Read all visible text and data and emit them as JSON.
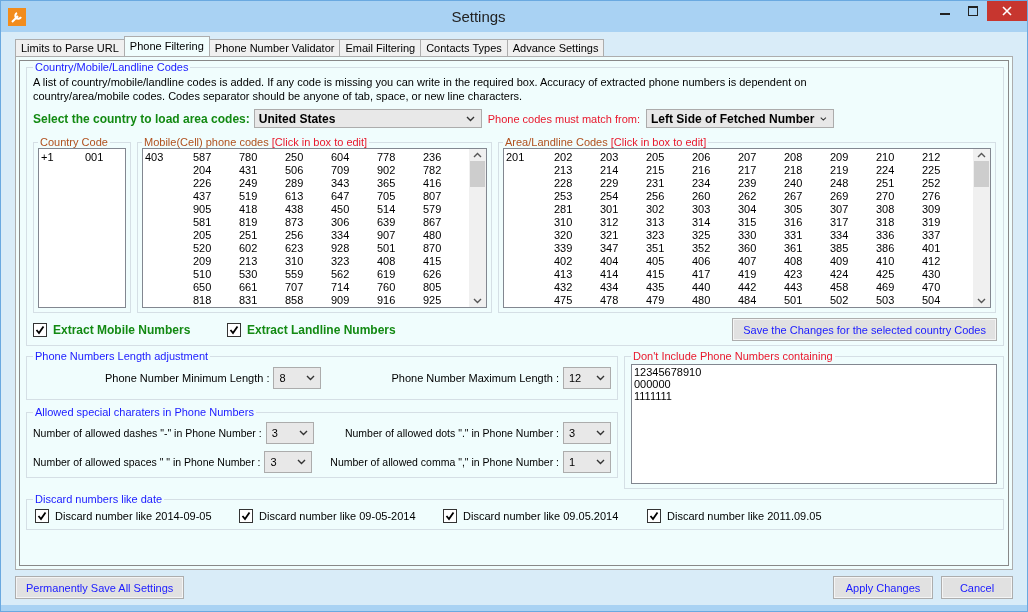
{
  "window": {
    "title": "Settings"
  },
  "tabs": [
    {
      "label": "Limits to Parse URL",
      "selected": false
    },
    {
      "label": "Phone Filtering",
      "selected": true
    },
    {
      "label": "Phone Number Validator",
      "selected": false
    },
    {
      "label": "Email Filtering",
      "selected": false
    },
    {
      "label": "Contacts Types",
      "selected": false
    },
    {
      "label": "Advance Settings",
      "selected": false
    }
  ],
  "codes_group": {
    "title": "Country/Mobile/Landline Codes",
    "description": "A list of country/mobile/landline codes is added. If any code is missing you can write in the required box. Accuracy of extracted phone numbers is dependent on country/area/mobile codes. Codes separator should be anyone of tab, space, or new line characters.",
    "country_select": {
      "label": "Select the country to load area codes:",
      "value": "United States"
    },
    "match_select": {
      "label": "Phone codes must match from:",
      "value": "Left Side of Fetched Number"
    },
    "country_codes": {
      "title": "Country Code",
      "values": [
        "+1",
        "001"
      ]
    },
    "mobile_codes": {
      "title": "Mobile(Cell) phone codes",
      "hint": "[Click in box to edit]",
      "first": "403",
      "rows": [
        [
          "587",
          "780",
          "250",
          "604",
          "778",
          "236"
        ],
        [
          "204",
          "431",
          "506",
          "709",
          "902",
          "782"
        ],
        [
          "226",
          "249",
          "289",
          "343",
          "365",
          "416"
        ],
        [
          "437",
          "519",
          "613",
          "647",
          "705",
          "807"
        ],
        [
          "905",
          "418",
          "438",
          "450",
          "514",
          "579"
        ],
        [
          "581",
          "819",
          "873",
          "306",
          "639",
          "867"
        ],
        [
          "205",
          "251",
          "256",
          "334",
          "907",
          "480"
        ],
        [
          "520",
          "602",
          "623",
          "928",
          "501",
          "870"
        ],
        [
          "209",
          "213",
          "310",
          "323",
          "408",
          "415"
        ],
        [
          "510",
          "530",
          "559",
          "562",
          "619",
          "626"
        ],
        [
          "650",
          "661",
          "707",
          "714",
          "760",
          "805"
        ],
        [
          "818",
          "831",
          "858",
          "909",
          "916",
          "925"
        ]
      ]
    },
    "area_codes": {
      "title": "Area/Landline Codes",
      "hint": "[Click in box to edit]",
      "first": "201",
      "rows": [
        [
          "202",
          "203",
          "205",
          "206",
          "207",
          "208",
          "209",
          "210",
          "212"
        ],
        [
          "213",
          "214",
          "215",
          "216",
          "217",
          "218",
          "219",
          "224",
          "225"
        ],
        [
          "228",
          "229",
          "231",
          "234",
          "239",
          "240",
          "248",
          "251",
          "252"
        ],
        [
          "253",
          "254",
          "256",
          "260",
          "262",
          "267",
          "269",
          "270",
          "276"
        ],
        [
          "281",
          "301",
          "302",
          "303",
          "304",
          "305",
          "307",
          "308",
          "309"
        ],
        [
          "310",
          "312",
          "313",
          "314",
          "315",
          "316",
          "317",
          "318",
          "319"
        ],
        [
          "320",
          "321",
          "323",
          "325",
          "330",
          "331",
          "334",
          "336",
          "337"
        ],
        [
          "339",
          "347",
          "351",
          "352",
          "360",
          "361",
          "385",
          "386",
          "401"
        ],
        [
          "402",
          "404",
          "405",
          "406",
          "407",
          "408",
          "409",
          "410",
          "412"
        ],
        [
          "413",
          "414",
          "415",
          "417",
          "419",
          "423",
          "424",
          "425",
          "430"
        ],
        [
          "432",
          "434",
          "435",
          "440",
          "442",
          "443",
          "458",
          "469",
          "470"
        ],
        [
          "475",
          "478",
          "479",
          "480",
          "484",
          "501",
          "502",
          "503",
          "504"
        ]
      ]
    },
    "extract_options": [
      {
        "label": "Extract Mobile Numbers",
        "checked": true
      },
      {
        "label": "Extract Landline Numbers",
        "checked": true
      }
    ],
    "save_button": "Save the Changes for the selected country Codes"
  },
  "length_group": {
    "title": "Phone Numbers Length adjustment",
    "fields": [
      {
        "label": "Phone Number Minimum Length :",
        "value": "8"
      },
      {
        "label": "Phone Number Maximum Length :",
        "value": "12"
      }
    ]
  },
  "special_group": {
    "title": "Allowed special charaters in Phone Numbers",
    "fields": [
      {
        "label": "Number of allowed dashes \"-\" in Phone Number :",
        "value": "3"
      },
      {
        "label": "Number of allowed dots \".\" in Phone Number :",
        "value": "3"
      },
      {
        "label": "Number of allowed spaces \" \" in Phone Number :",
        "value": "3"
      },
      {
        "label": "Number of allowed  comma \",\" in Phone Number :",
        "value": "1"
      }
    ]
  },
  "exclude_group": {
    "title": "Don't Include Phone Numbers containing",
    "lines": [
      "12345678910",
      "000000",
      "1111111"
    ]
  },
  "date_group": {
    "title": "Discard numbers like date",
    "options": [
      {
        "label": "Discard number like 2014-09-05",
        "checked": true
      },
      {
        "label": "Discard number like 09-05-2014",
        "checked": true
      },
      {
        "label": "Discard number like 09.05.2014",
        "checked": true
      },
      {
        "label": "Discard number like 2011.09.05",
        "checked": true
      }
    ]
  },
  "buttons": {
    "save_all": "Permanently Save All Settings",
    "apply": "Apply Changes",
    "cancel": "Cancel"
  }
}
